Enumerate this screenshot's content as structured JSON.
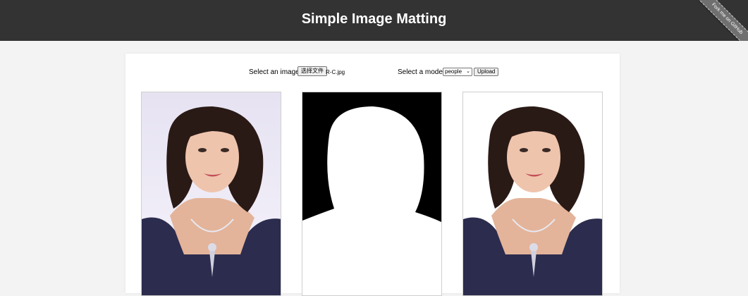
{
  "header": {
    "title": "Simple Image Matting",
    "ribbon_label": "Fork me on GitHub"
  },
  "controls": {
    "select_image_label": "Select an image:",
    "choose_file_button": "选择文件",
    "file_name": "R-C.jpg",
    "select_model_label": "Select a model:",
    "model_selected": "people",
    "upload_button": "Upload"
  },
  "images": [
    {
      "name": "original-image",
      "background": "#eeeaf6"
    },
    {
      "name": "alpha-matte-image",
      "background": "#000000"
    },
    {
      "name": "matted-result-image",
      "background": "#ffffff"
    }
  ],
  "colors": {
    "header_bg": "#333333",
    "page_bg": "#f3f3f3",
    "panel_bg": "#ffffff"
  }
}
